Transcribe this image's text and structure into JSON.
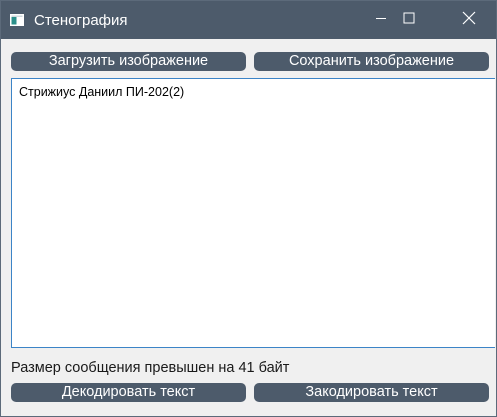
{
  "window": {
    "title": "Стенография"
  },
  "icons": {
    "app": "app-window-icon",
    "minimize": "minimize-icon",
    "maximize": "maximize-icon",
    "close": "close-icon"
  },
  "toolbar": {
    "load_label": "Загрузить изображение",
    "save_label": "Сохранить изображение"
  },
  "editor": {
    "text": "Стрижиус Даниил ПИ-202(2)"
  },
  "status": {
    "message": "Размер сообщения превышен на 41 байт"
  },
  "actions": {
    "decode_label": "Декодировать текст",
    "encode_label": "Закодировать текст"
  },
  "colors": {
    "titlebar": "#4d5b6b",
    "button": "#4d5b6b",
    "background": "#f0f0f0",
    "editor_border": "#3c84c7"
  }
}
